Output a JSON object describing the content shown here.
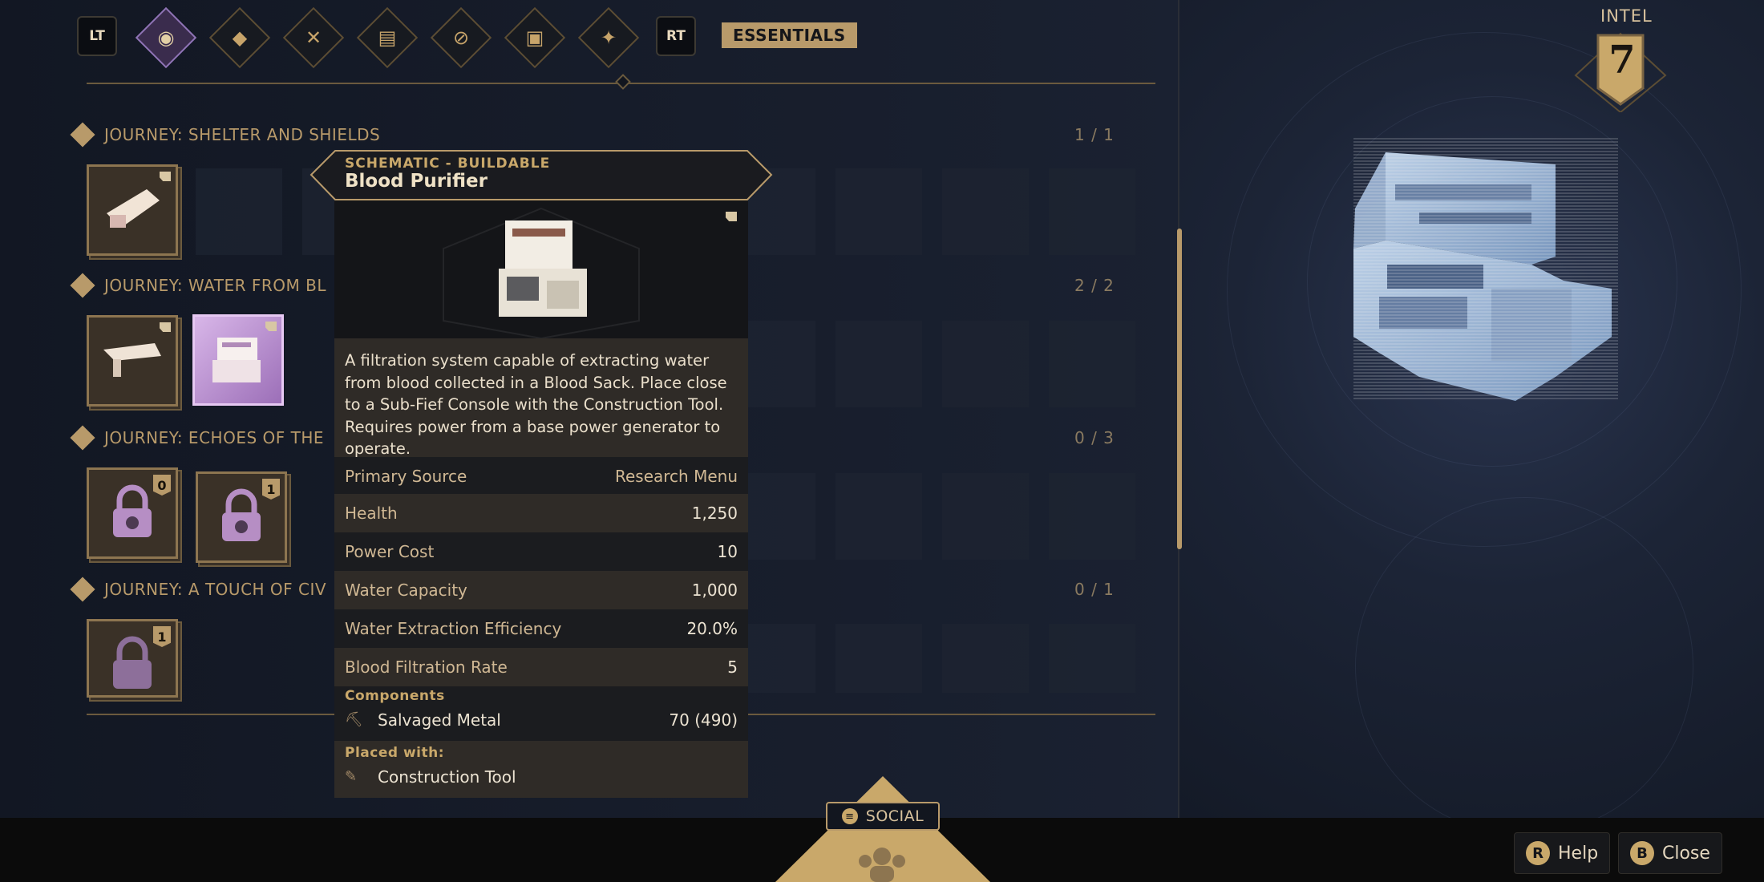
{
  "nav": {
    "left_key": "LT",
    "right_key": "RT",
    "tabs": [
      {
        "icon": "sun-icon",
        "active": true
      },
      {
        "icon": "water-drop-icon",
        "active": false
      },
      {
        "icon": "crossed-blades-icon",
        "active": false
      },
      {
        "icon": "bricks-icon",
        "active": false
      },
      {
        "icon": "no-entry-icon",
        "active": false
      },
      {
        "icon": "backpack-icon",
        "active": false
      },
      {
        "icon": "star-burst-icon",
        "active": false
      }
    ],
    "category": "ESSENTIALS"
  },
  "intel": {
    "label": "INTEL",
    "value": "7"
  },
  "sections": [
    {
      "title": "JOURNEY: SHELTER AND SHIELDS",
      "count": "1 / 1"
    },
    {
      "title": "JOURNEY: WATER FROM BL",
      "count": "2 / 2"
    },
    {
      "title": "JOURNEY: ECHOES OF THE",
      "count": "0 / 3"
    },
    {
      "title": "JOURNEY: A TOUCH OF CIV",
      "count": "0 / 1"
    }
  ],
  "locked_slots": [
    {
      "badge": "0"
    },
    {
      "badge": "1"
    },
    {
      "badge": "1"
    }
  ],
  "tooltip": {
    "kind": "SCHEMATIC - BUILDABLE",
    "name": "Blood Purifier",
    "description": "A filtration system capable of extracting water from blood collected in a Blood Sack. Place close to a Sub-Fief Console with the Construction Tool. Requires power from a base power generator to operate.",
    "stats": [
      {
        "key": "Primary Source",
        "value": "Research Menu"
      },
      {
        "key": "Health",
        "value": "1,250"
      },
      {
        "key": "Power Cost",
        "value": "10"
      },
      {
        "key": "Water Capacity",
        "value": "1,000"
      },
      {
        "key": "Water Extraction Efficiency",
        "value": "20.0%"
      },
      {
        "key": "Blood Filtration Rate",
        "value": "5"
      }
    ],
    "components_label": "Components",
    "components": [
      {
        "name": "Salvaged Metal",
        "value": "70 (490)",
        "icon": "metal-scrap-icon"
      }
    ],
    "placed_with_label": "Placed with:",
    "placed_with": [
      {
        "name": "Construction Tool",
        "icon": "construction-tool-icon"
      }
    ]
  },
  "social": {
    "label": "SOCIAL"
  },
  "hints": [
    {
      "key": "R",
      "label": "Help"
    },
    {
      "key": "B",
      "label": "Close"
    }
  ],
  "colors": {
    "accent": "#b89a6a",
    "selected": "#d8b6e8",
    "panel": "#1b1c1f"
  }
}
